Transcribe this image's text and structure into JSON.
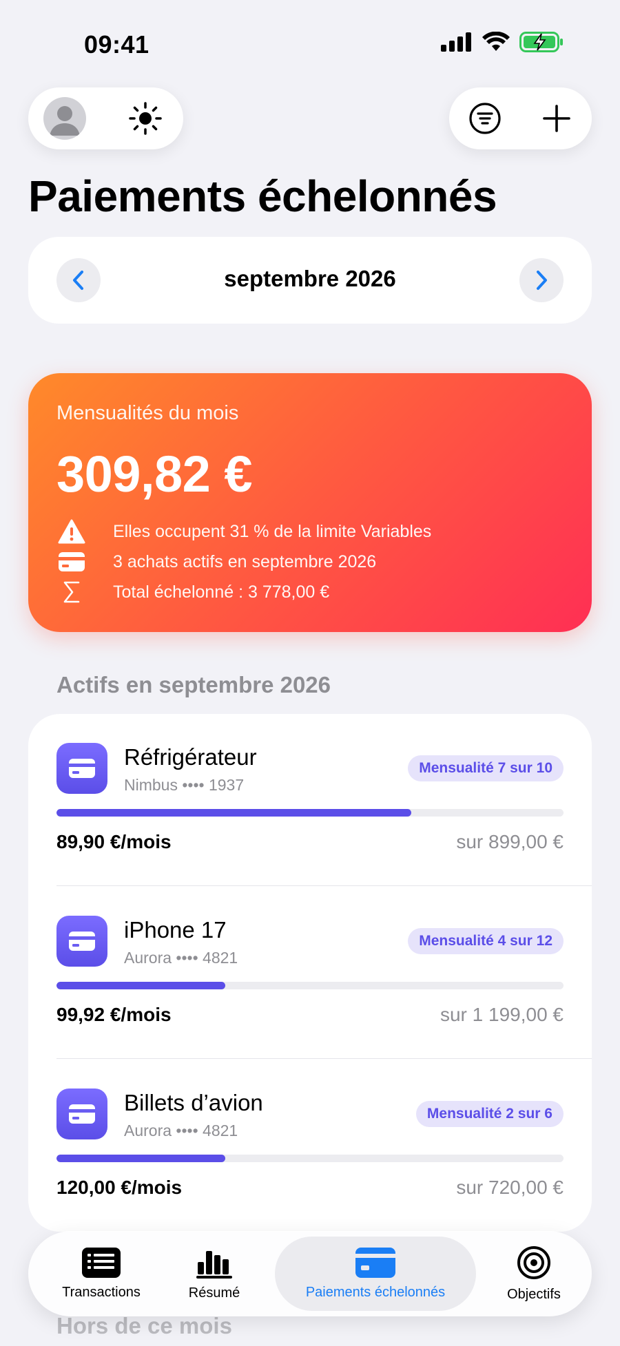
{
  "status_bar": {
    "time": "09:41"
  },
  "page": {
    "title": "Paiements échelonnés"
  },
  "month_nav": {
    "label": "septembre 2026"
  },
  "summary": {
    "label": "Mensualités du mois",
    "amount": "309,82 €",
    "lines": [
      "Elles occupent 31 % de la limite Variables",
      "3 achats actifs en septembre 2026",
      "Total échelonné : 3 778,00 €"
    ],
    "gradient_colors": [
      "#ff8a2a",
      "#ff2f54"
    ]
  },
  "section": {
    "title": "Actifs en septembre 2026"
  },
  "items": [
    {
      "name": "Réfrigérateur",
      "card": "Nimbus •••• 1937",
      "badge": "Mensualité 7 sur 10",
      "monthly": "89,90 €/mois",
      "total": "sur 899,00 €",
      "progress": 0.7
    },
    {
      "name": "iPhone 17",
      "card": "Aurora •••• 4821",
      "badge": "Mensualité 4 sur 12",
      "monthly": "99,92 €/mois",
      "total": "sur 1 199,00 €",
      "progress": 0.333
    },
    {
      "name": "Billets d’avion",
      "card": "Aurora •••• 4821",
      "badge": "Mensualité 2 sur 6",
      "monthly": "120,00 €/mois",
      "total": "sur 720,00 €",
      "progress": 0.333
    }
  ],
  "below_fold": {
    "section_title": "Hors de ce mois"
  },
  "tabs": [
    {
      "label": "Transactions",
      "icon": "list-icon"
    },
    {
      "label": "Résumé",
      "icon": "bar-chart-icon"
    },
    {
      "label": "Paiements échelonnés",
      "icon": "credit-card-icon",
      "active": true
    },
    {
      "label": "Objectifs",
      "icon": "target-icon"
    }
  ],
  "colors": {
    "accent": "#5b4ee8",
    "tab_active": "#1a7ef5",
    "nav_arrow": "#1a7ef5"
  }
}
